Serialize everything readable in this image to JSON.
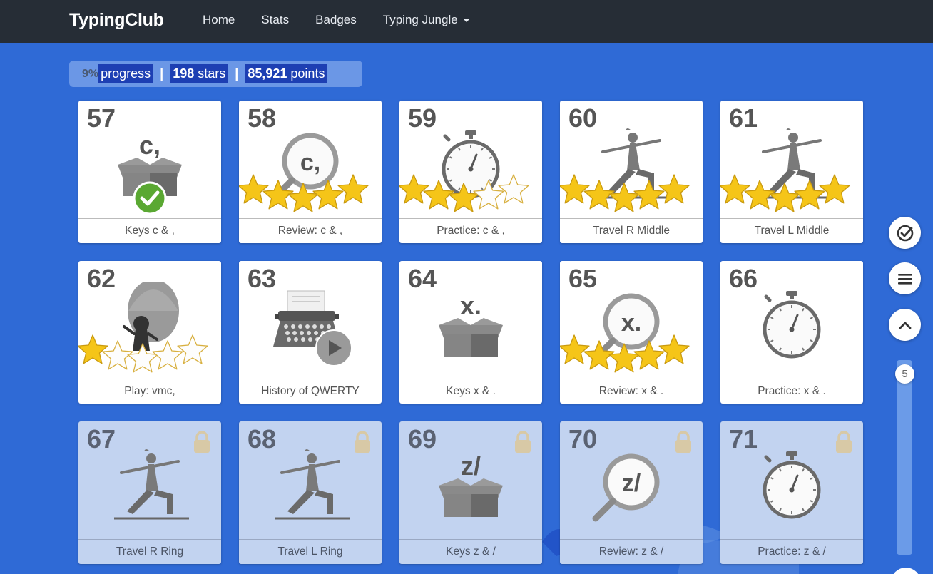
{
  "nav": {
    "brand": "TypingClub",
    "links": [
      "Home",
      "Stats",
      "Badges",
      "Typing Jungle"
    ]
  },
  "stats": {
    "progress_pct": "9%",
    "progress_label": "progress",
    "stars_value": "198",
    "stars_label": "stars",
    "points_value": "85,921",
    "points_label": "points",
    "separator": "|"
  },
  "lessons": [
    {
      "num": "57",
      "label": "Keys c & ,",
      "icon": "box-keys-icon",
      "glyph": "c,",
      "stars": 0,
      "completed": true,
      "locked": false
    },
    {
      "num": "58",
      "label": "Review: c & ,",
      "icon": "magnifier-icon",
      "glyph": "c,",
      "stars": 5,
      "locked": false
    },
    {
      "num": "59",
      "label": "Practice: c & ,",
      "icon": "stopwatch-icon",
      "stars": 3,
      "locked": false
    },
    {
      "num": "60",
      "label": "Travel R Middle",
      "icon": "yoga-pose-icon",
      "stars": 5,
      "locked": false
    },
    {
      "num": "61",
      "label": "Travel L Middle",
      "icon": "yoga-pose-icon",
      "stars": 5,
      "locked": false
    },
    {
      "num": "62",
      "label": "Play: vmc,",
      "icon": "balloon-game-icon",
      "stars": 1,
      "locked": false
    },
    {
      "num": "63",
      "label": "History of QWERTY",
      "icon": "typewriter-video-icon",
      "stars": 0,
      "locked": false
    },
    {
      "num": "64",
      "label": "Keys x & .",
      "icon": "box-keys-icon",
      "glyph": "x.",
      "stars": 0,
      "locked": false
    },
    {
      "num": "65",
      "label": "Review: x & .",
      "icon": "magnifier-icon",
      "glyph": "x.",
      "stars": 5,
      "locked": false
    },
    {
      "num": "66",
      "label": "Practice: x & .",
      "icon": "stopwatch-icon",
      "stars": 0,
      "locked": false
    },
    {
      "num": "67",
      "label": "Travel R Ring",
      "icon": "yoga-pose-icon",
      "stars": 0,
      "locked": true
    },
    {
      "num": "68",
      "label": "Travel L Ring",
      "icon": "yoga-pose-icon",
      "stars": 0,
      "locked": true
    },
    {
      "num": "69",
      "label": "Keys z & /",
      "icon": "box-keys-icon",
      "glyph": "z/",
      "stars": 0,
      "locked": true
    },
    {
      "num": "70",
      "label": "Review: z & /",
      "icon": "magnifier-icon",
      "glyph": "z/",
      "stars": 0,
      "locked": true
    },
    {
      "num": "71",
      "label": "Practice: z & /",
      "icon": "stopwatch-icon",
      "stars": 0,
      "locked": true
    }
  ],
  "side_controls": {
    "check_icon": "check-circle-icon",
    "menu_icon": "hamburger-menu-icon",
    "up_icon": "chevron-up-icon",
    "scroll_page": "5"
  },
  "colors": {
    "background": "#2f6ad6",
    "topbar": "#262d36",
    "star_fill": "#f5c518",
    "check_green": "#5aa832"
  }
}
